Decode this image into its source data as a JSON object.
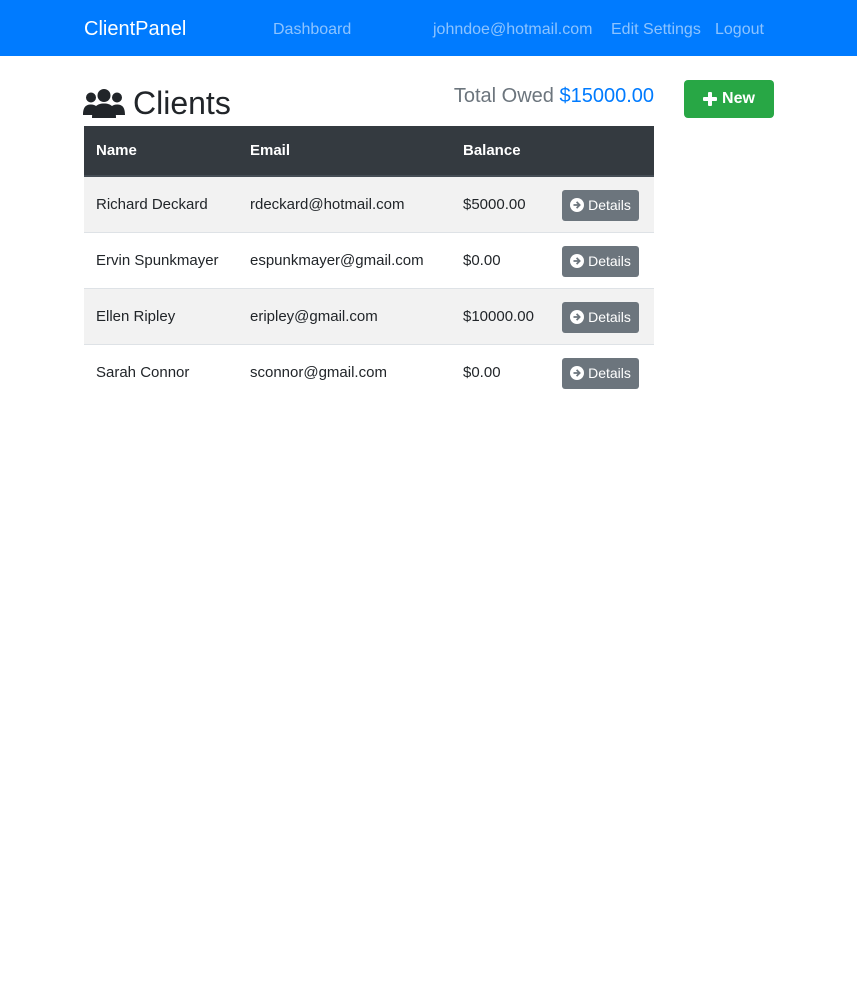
{
  "navbar": {
    "brand": "ClientPanel",
    "links": {
      "dashboard": "Dashboard",
      "user_email": "johndoe@hotmail.com",
      "edit_settings": "Edit Settings",
      "logout": "Logout"
    }
  },
  "page": {
    "title": "Clients",
    "title_icon": "users-icon",
    "total_owed_label": "Total Owed",
    "total_owed_value": "$15000.00",
    "new_button_label": "New",
    "new_button_icon": "plus-icon"
  },
  "table": {
    "headers": [
      "Name",
      "Email",
      "Balance",
      ""
    ],
    "rows": [
      {
        "name": "Richard Deckard",
        "email": "rdeckard@hotmail.com",
        "balance": "$5000.00",
        "action_label": "Details"
      },
      {
        "name": "Ervin Spunkmayer",
        "email": "espunkmayer@gmail.com",
        "balance": "$0.00",
        "action_label": "Details"
      },
      {
        "name": "Ellen Ripley",
        "email": "eripley@gmail.com",
        "balance": "$10000.00",
        "action_label": "Details"
      },
      {
        "name": "Sarah Connor",
        "email": "sconnor@gmail.com",
        "balance": "$0.00",
        "action_label": "Details"
      }
    ],
    "action_icon": "arrow-circle-right-icon"
  },
  "colors": {
    "navbar_bg": "#007bff",
    "table_header_bg": "#343a40",
    "new_button_bg": "#28a745",
    "details_button_bg": "#6c757d",
    "total_value": "#007bff",
    "striped_row_bg": "#f2f2f2"
  }
}
